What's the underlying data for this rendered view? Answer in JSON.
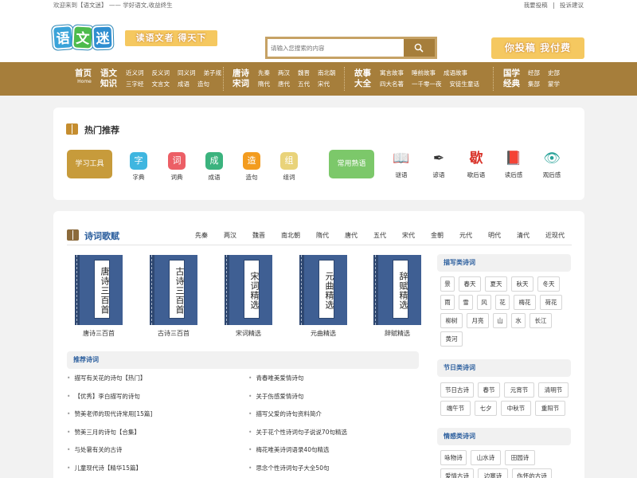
{
  "topbar": {
    "welcome": "欢迎来到【语文迷】 —— 学好语文,收益终生",
    "links": [
      "我要投稿",
      "|",
      "投诉建议"
    ]
  },
  "header": {
    "logo_chars": [
      "语",
      "文",
      "迷"
    ],
    "slogan": "读语文者 得天下",
    "search_placeholder": "请输入您搜索的内容",
    "contribute": "你投稿 我付费"
  },
  "nav": [
    {
      "title": [
        "首页",
        "Home"
      ],
      "links": []
    },
    {
      "title": [
        "语文",
        "知识"
      ],
      "links": [
        [
          "近义词",
          "反义词",
          "同义词",
          "弟子规"
        ],
        [
          "三字经",
          "文言文",
          "成语",
          "造句"
        ]
      ]
    },
    {
      "title": [
        "唐诗",
        "宋词"
      ],
      "links": [
        [
          "先秦",
          "两汉",
          "魏晋",
          "南北朝"
        ],
        [
          "隋代",
          "唐代",
          "五代",
          "宋代"
        ]
      ]
    },
    {
      "title": [
        "故事",
        "大全"
      ],
      "links": [
        [
          "寓言故事",
          "睡前故事",
          "成语故事"
        ],
        [
          "四大名著",
          "一千零一夜",
          "安徒生童话"
        ]
      ]
    },
    {
      "title": [
        "国学",
        "经典"
      ],
      "links": [
        [
          "经部",
          "史部"
        ],
        [
          "集部",
          "蒙学"
        ]
      ]
    }
  ],
  "hot": {
    "title": "热门推荐",
    "study_tools_label": "学习工具",
    "study_tools": [
      {
        "label": "字典",
        "icon": "字",
        "color": "#3fb6e0"
      },
      {
        "label": "词典",
        "icon": "词",
        "color": "#ec5f66"
      },
      {
        "label": "成语",
        "icon": "成",
        "color": "#3bb37e"
      },
      {
        "label": "造句",
        "icon": "造",
        "color": "#f39c1f"
      },
      {
        "label": "组词",
        "icon": "组",
        "color": "#e9d37a"
      }
    ],
    "idioms_label": "常用熟语",
    "idioms": [
      {
        "label": "谜语",
        "icon": "📖",
        "color": "#c58d2f"
      },
      {
        "label": "谚语",
        "icon": "✒",
        "color": "#333333"
      },
      {
        "label": "歇后语",
        "icon": "歇",
        "color": "#d9342b"
      },
      {
        "label": "读后感",
        "icon": "📕",
        "color": "#d9342b"
      },
      {
        "label": "观后感",
        "icon": "👁",
        "color": "#2aa39a"
      }
    ]
  },
  "poetry": {
    "title": "诗词歌赋",
    "dynasties": [
      "先秦",
      "两汉",
      "魏晋",
      "南北朝",
      "隋代",
      "唐代",
      "五代",
      "宋代",
      "金朝",
      "元代",
      "明代",
      "清代",
      "近现代"
    ],
    "books": [
      {
        "cover": "唐诗三百首",
        "label": "唐诗三百首"
      },
      {
        "cover": "古诗三百首",
        "label": "古诗三百首"
      },
      {
        "cover": "宋词精选",
        "label": "宋词精选"
      },
      {
        "cover": "元曲精选",
        "label": "元曲精选"
      },
      {
        "cover": "辞赋精选",
        "label": "辞赋精选"
      }
    ],
    "recommend_title": "推荐诗词",
    "recommend_left": [
      "描写有关花的诗句【热门】",
      "【优秀】李白描写的诗句",
      "赞美老师的现代诗常用[15篇]",
      "赞美三月的诗句【合集】",
      "与处暑有关的古诗",
      "儿童现代诗【精华15篇】"
    ],
    "recommend_right": [
      "青春唯美爱情诗句",
      "关于伤感爱情诗句",
      "描写父爱的诗句资料简介",
      "关于花个性诗词句子说说70句精选",
      "梅花唯美诗词语录40句精选",
      "思念个性诗词句子大全50句"
    ]
  },
  "sidebar": [
    {
      "title": "描写类诗词",
      "items": [
        "景",
        "春天",
        "夏天",
        "秋天",
        "冬天",
        "雨",
        "雪",
        "风",
        "花",
        "梅花",
        "荷花",
        "柳树",
        "月亮",
        "山",
        "水",
        "长江",
        "黄河"
      ]
    },
    {
      "title": "节日类诗词",
      "items": [
        "节日古诗",
        "春节",
        "元宵节",
        "清明节",
        "端午节",
        "七夕",
        "中秋节",
        "重阳节"
      ]
    },
    {
      "title": "情感类诗词",
      "items": [
        "咏物诗",
        "山水诗",
        "田园诗",
        "爱情古诗",
        "边塞诗",
        "伤怀的古诗"
      ]
    }
  ]
}
